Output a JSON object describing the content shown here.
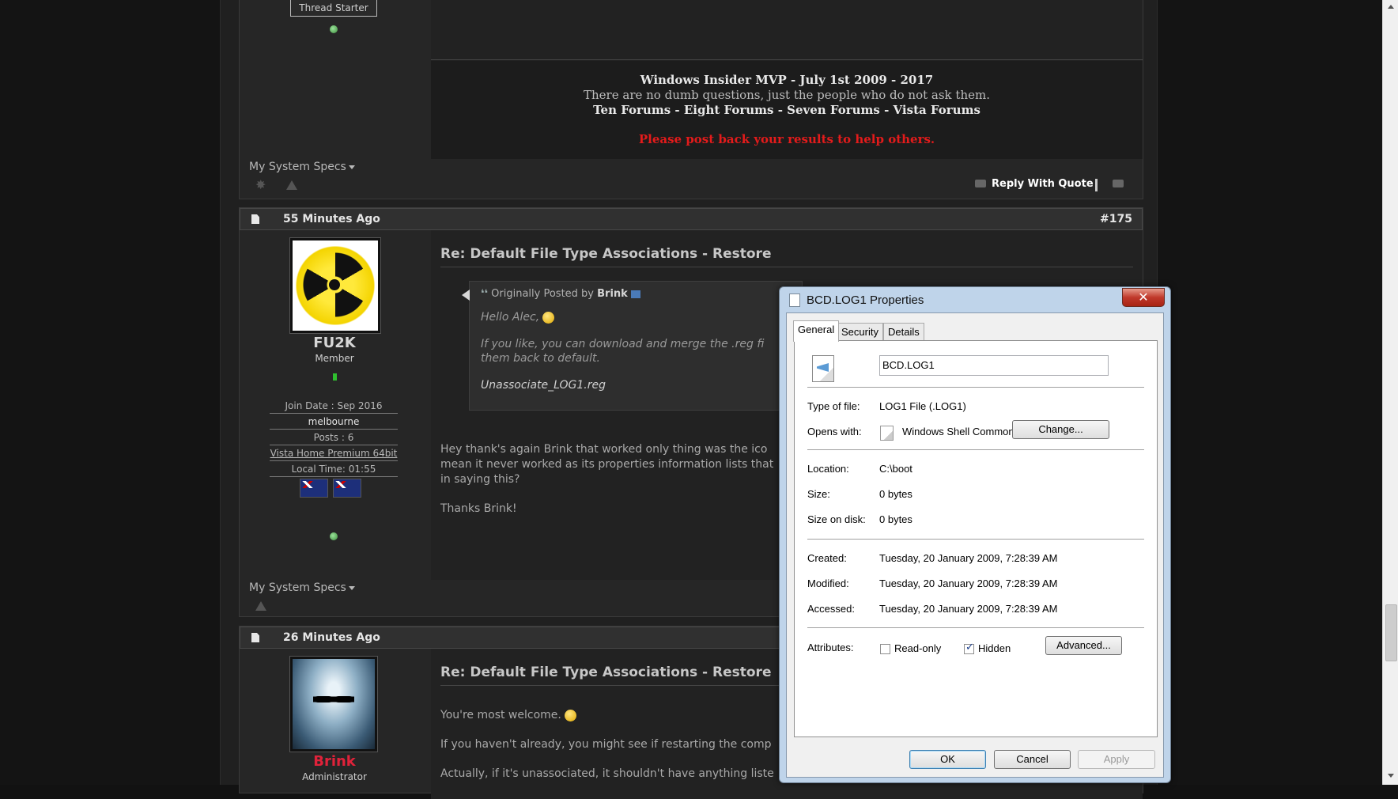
{
  "post1": {
    "thread_starter_alt": "Thread Starter",
    "sig_line1": "Windows Insider MVP - July 1st 2009 - 2017",
    "sig_line2": "There are no dumb questions, just the people who do not ask them.",
    "sig_forums": [
      "Ten Forums",
      "Eight Forums",
      "Seven Forums",
      "Vista Forums"
    ],
    "sig_sep": " - ",
    "sig_red": "Please post back your results to help others.",
    "specs_label": "My System Specs",
    "reply_label": "Reply With Quote"
  },
  "post2": {
    "time": "55 Minutes Ago",
    "number": "#175",
    "username": "FU2K",
    "rank": "Member",
    "info": [
      "Join Date : Sep 2016",
      "melbourne",
      "Posts : 6",
      "Vista Home Premium 64bit",
      "Local Time: 01:55"
    ],
    "title": "Re: Default File Type Associations - Restore",
    "quote_prefix": "Originally Posted by",
    "quote_author": "Brink",
    "quote_lines": [
      "Hello Alec,",
      "If you like, you can download and merge the .reg fi",
      "them back to default.",
      "Unassociate_LOG1.reg"
    ],
    "body_lines": [
      "Hey thank's again Brink that worked only thing was the ico",
      "mean it never worked as its properties information lists that",
      "in saying this?"
    ],
    "thanks": "Thanks Brink!",
    "specs_label": "My System Specs"
  },
  "post3": {
    "time": "26 Minutes Ago",
    "username": "Brink",
    "rank": "Administrator",
    "title": "Re: Default File Type Associations - Restore",
    "lines": [
      "You're most welcome.",
      "If you haven't already, you might see if restarting the comp",
      "Actually, if it's unassociated, it shouldn't have anything liste"
    ]
  },
  "dialog": {
    "title": "BCD.LOG1 Properties",
    "close": "✕",
    "tabs": [
      "General",
      "Security",
      "Details"
    ],
    "filename": "BCD.LOG1",
    "type_label": "Type of file:",
    "type_value": "LOG1 File (.LOG1)",
    "opens_label": "Opens with:",
    "opens_value": "Windows Shell Common",
    "change_button": "Change...",
    "location_label": "Location:",
    "location_value": "C:\\boot",
    "size_label": "Size:",
    "size_value": "0 bytes",
    "size_disk_label": "Size on disk:",
    "size_disk_value": "0 bytes",
    "created_label": "Created:",
    "created_value": "Tuesday, 20 January 2009, 7:28:39 AM",
    "modified_label": "Modified:",
    "modified_value": "Tuesday, 20 January 2009, 7:28:39 AM",
    "accessed_label": "Accessed:",
    "accessed_value": "Tuesday, 20 January 2009, 7:28:39 AM",
    "attributes_label": "Attributes:",
    "readonly_label": "Read-only",
    "readonly_checked": false,
    "hidden_label": "Hidden",
    "hidden_checked": true,
    "advanced_button": "Advanced...",
    "ok_button": "OK",
    "cancel_button": "Cancel",
    "apply_button": "Apply"
  },
  "colors": {
    "accent_red": "#e31b1b",
    "admin_red": "#e0223a"
  }
}
